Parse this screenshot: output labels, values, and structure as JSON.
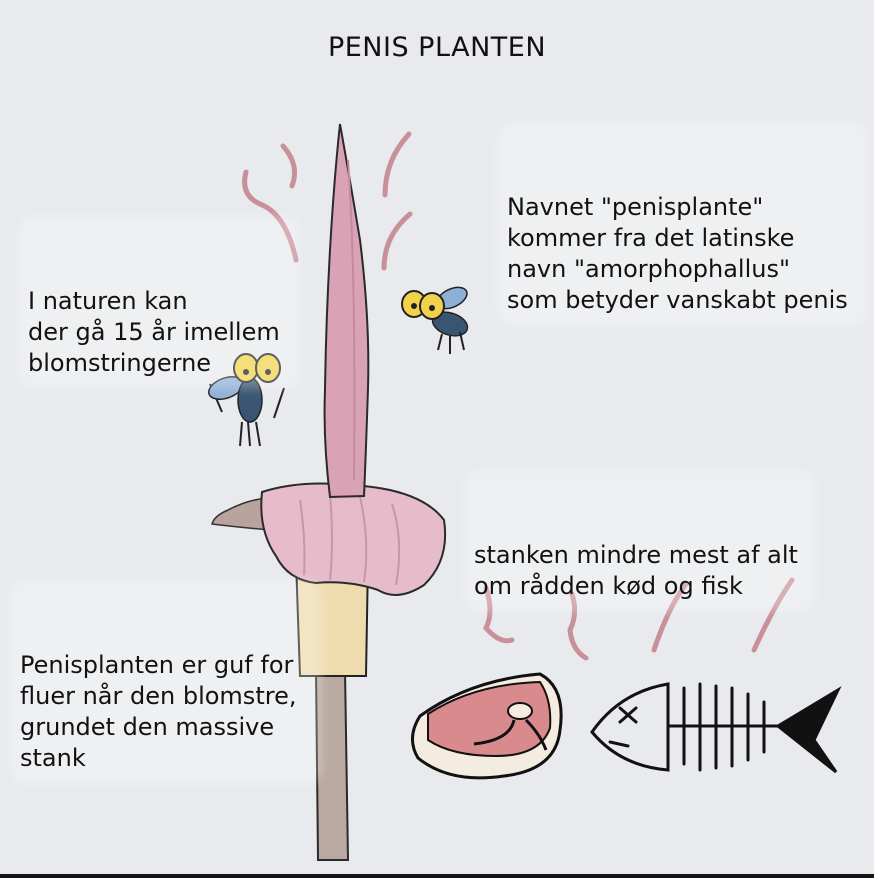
{
  "title": "PENIS PLANTEN",
  "notes": {
    "name": "Navnet \"penisplante\"\nkommer fra det latinske\nnavn \"amorphophallus\"\nsom betyder vanskabt penis",
    "nature": "I naturen kan\nder gå 15 år imellem\nblomstringerne",
    "stench": "stanken mindre mest af alt\nom rådden kød og fisk",
    "flies": "Penisplanten er guf for\nfluer når den blomstre,\ngrundet den massive\nstank"
  },
  "colors": {
    "background": "#e8eaee",
    "spadix_pink": "#d9a3b5",
    "spathe_pink": "#e6bccb",
    "stem_beige": "#efdcae",
    "stalk_grey": "#b9a9a1",
    "stink_lines": "#c89098",
    "meat_red": "#d98a8c",
    "fly_body": "#3a5572",
    "fly_wings": "#8fb0d6",
    "fly_eyes": "#f2d24a"
  },
  "icons": [
    "plant-illustration",
    "fly-icon",
    "meat-icon",
    "fish-skeleton-icon",
    "stink-line"
  ]
}
